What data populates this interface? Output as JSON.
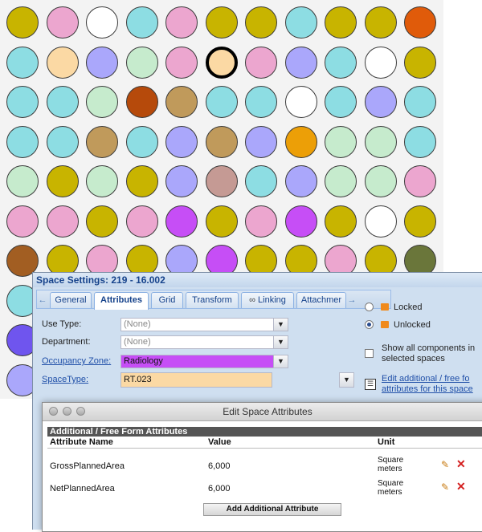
{
  "grid": {
    "colors": {
      "olive": "#c8b400",
      "pink": "#eca6cf",
      "white": "#ffffff",
      "cyan": "#8ddde3",
      "green": "#c6ebcd",
      "peach": "#fbd9a4",
      "lavender": "#aaa7fb",
      "rust": "#b64a0b",
      "tan": "#c09a5b",
      "orange": "#ec9f07",
      "mauve": "#c59a94",
      "magenta": "#c64ef6",
      "brown": "#a25e22",
      "darkolive": "#6a763a",
      "purple": "#6f55ee",
      "orangered": "#e05b0a"
    },
    "rows": [
      [
        "olive",
        "pink",
        "white",
        "cyan",
        "pink",
        "olive",
        "olive",
        "cyan",
        "olive",
        "olive",
        "orangered"
      ],
      [
        "cyan",
        "peach",
        "lavender",
        "green",
        "pink",
        "peach",
        "pink",
        "lavender",
        "cyan",
        "white",
        "olive"
      ],
      [
        "cyan",
        "cyan",
        "green",
        "rust",
        "tan",
        "cyan",
        "cyan",
        "white",
        "cyan",
        "lavender",
        "cyan"
      ],
      [
        "cyan",
        "cyan",
        "tan",
        "cyan",
        "lavender",
        "tan",
        "lavender",
        "orange",
        "green",
        "green",
        "cyan"
      ],
      [
        "green",
        "olive",
        "green",
        "olive",
        "lavender",
        "mauve",
        "cyan",
        "lavender",
        "green",
        "green",
        "pink"
      ],
      [
        "pink",
        "pink",
        "olive",
        "pink",
        "magenta",
        "olive",
        "pink",
        "magenta",
        "olive",
        "white",
        "olive"
      ],
      [
        "brown",
        "olive",
        "pink",
        "olive",
        "lavender",
        "magenta",
        "olive",
        "olive",
        "pink",
        "olive",
        "darkolive"
      ],
      [
        "cyan",
        "",
        "",
        "",
        "",
        "",
        "",
        "",
        "",
        "",
        ""
      ],
      [
        "purple",
        "",
        "",
        "",
        "",
        "",
        "",
        "",
        "",
        "",
        ""
      ],
      [
        "lavender",
        "",
        "",
        "",
        "",
        "",
        "",
        "",
        "",
        "",
        ""
      ]
    ],
    "selected": [
      1,
      5
    ]
  },
  "space_settings": {
    "title": "Space Settings: 219 - 16.002",
    "tabs": [
      "General",
      "Attributes",
      "Grid",
      "Transform",
      "Linking",
      "Attachmer"
    ],
    "active_tab": "Attributes",
    "scroll_left": "←",
    "scroll_right": "→",
    "fields": {
      "use_type": {
        "label": "Use Type:",
        "value": "(None)"
      },
      "department": {
        "label": "Department:",
        "value": "(None)"
      },
      "occupancy_zone": {
        "label": "Occupancy Zone:",
        "value": "Radiology",
        "color": "#c64ef6"
      },
      "space_type": {
        "label": "SpaceType:",
        "value": "RT.023",
        "color": "#fbd9a4"
      }
    },
    "lock_options": {
      "locked": "Locked",
      "unlocked": "Unlocked",
      "selected": "unlocked"
    },
    "show_all_label_line1": "Show all components in",
    "show_all_label_line2": "selected spaces",
    "edit_link_line1": "Edit additional / free fo",
    "edit_link_line2": "attributes for this space"
  },
  "edit_dialog": {
    "title": "Edit Space Attributes",
    "section_header": "Additional / Free Form Attributes",
    "columns": {
      "name": "Attribute Name",
      "value": "Value",
      "unit": "Unit"
    },
    "rows": [
      {
        "name": "GrossPlannedArea",
        "value": "6,000",
        "unit_line1": "Square",
        "unit_line2": "meters"
      },
      {
        "name": "NetPlannedArea",
        "value": "6,000",
        "unit_line1": "Square",
        "unit_line2": "meters"
      }
    ],
    "add_button": "Add Additional Attribute"
  },
  "icons": {
    "edit": "pencil-icon",
    "delete": "delete-x-icon",
    "chevron": "chevron-down-icon",
    "link": "chain-link-icon",
    "lock": "lock-icon",
    "list": "list-icon"
  }
}
